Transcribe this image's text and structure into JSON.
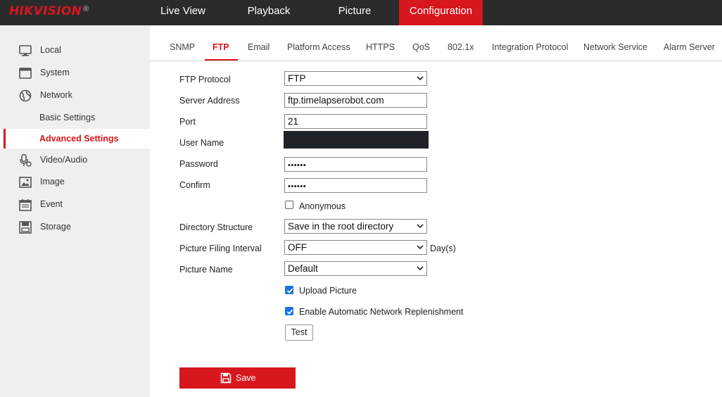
{
  "brand": {
    "logo": "HIKVISION",
    "registered": "®"
  },
  "nav": [
    {
      "label": "Live View"
    },
    {
      "label": "Playback"
    },
    {
      "label": "Picture"
    },
    {
      "label": "Configuration",
      "active": true
    }
  ],
  "sidebar": {
    "items": [
      {
        "label": "Local",
        "icon": "monitor-icon"
      },
      {
        "label": "System",
        "icon": "window-icon"
      },
      {
        "label": "Network",
        "icon": "globe-icon"
      },
      {
        "label": "Basic Settings"
      },
      {
        "label": "Advanced Settings",
        "active": true
      },
      {
        "label": "Video/Audio",
        "icon": "microphone-camera-icon"
      },
      {
        "label": "Image",
        "icon": "image-icon"
      },
      {
        "label": "Event",
        "icon": "calendar-icon"
      },
      {
        "label": "Storage",
        "icon": "storage-icon"
      }
    ]
  },
  "tabs": [
    {
      "label": "SNMP"
    },
    {
      "label": "FTP",
      "active": true
    },
    {
      "label": "Email"
    },
    {
      "label": "Platform Access"
    },
    {
      "label": "HTTPS"
    },
    {
      "label": "QoS"
    },
    {
      "label": "802.1x"
    },
    {
      "label": "Integration Protocol"
    },
    {
      "label": "Network Service"
    },
    {
      "label": "Alarm Server"
    }
  ],
  "form": {
    "ftp_protocol": {
      "label": "FTP Protocol",
      "value": "FTP"
    },
    "server_address": {
      "label": "Server Address",
      "value": "ftp.timelapserobot.com"
    },
    "port": {
      "label": "Port",
      "value": "21"
    },
    "user_name": {
      "label": "User Name"
    },
    "password": {
      "label": "Password",
      "value": "••••••"
    },
    "confirm": {
      "label": "Confirm",
      "value": "••••••"
    },
    "anonymous": {
      "label": "Anonymous",
      "checked": false
    },
    "directory_structure": {
      "label": "Directory Structure",
      "value": "Save in the root directory"
    },
    "picture_filing_interval": {
      "label": "Picture Filing Interval",
      "value": "OFF",
      "unit": "Day(s)"
    },
    "picture_name": {
      "label": "Picture Name",
      "value": "Default"
    },
    "upload_picture": {
      "label": "Upload Picture",
      "checked": true
    },
    "enable_replenishment": {
      "label": "Enable Automatic Network Replenishment",
      "checked": true
    },
    "test_label": "Test"
  },
  "save_label": "Save",
  "colors": {
    "accent": "#d7161e",
    "topbar": "#2b2b2b",
    "sidebar": "#efefef",
    "checkbox": "#1a73e8"
  }
}
